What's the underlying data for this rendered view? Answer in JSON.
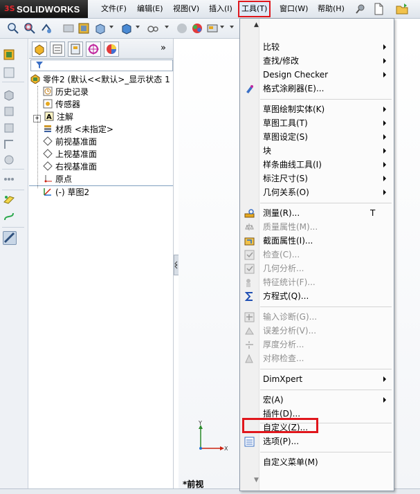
{
  "app": {
    "logo_mark": "3S",
    "logo_text": "SOLIDWORKS"
  },
  "menubar": [
    "文件(F)",
    "编辑(E)",
    "视图(V)",
    "插入(I)",
    "工具(T)",
    "窗口(W)",
    "帮助(H)"
  ],
  "feature_tree": {
    "items": [
      "零件2 (默认<<默认>_显示状态 1",
      "历史记录",
      "传感器",
      "注解",
      "材质 <未指定>",
      "前视基准面",
      "上视基准面",
      "右视基准面",
      "原点",
      "(-) 草图2"
    ],
    "expand_glyph": "+",
    "tab_more": "»"
  },
  "view": {
    "label": "*前视",
    "axis_x": "X",
    "axis_y": "Y"
  },
  "tools_menu": {
    "scroll_up": "▲",
    "scroll_down": "▼",
    "items": [
      "比较",
      "查找/修改",
      "Design Checker",
      "格式涂刷器(E)...",
      "草图绘制实体(K)",
      "草图工具(T)",
      "草图设定(S)",
      "块",
      "样条曲线工具(I)",
      "标注尺寸(S)",
      "几何关系(O)",
      "测量(R)...",
      "质量属性(M)...",
      "截面属性(I)...",
      "检查(C)...",
      "几何分析...",
      "特征统计(F)...",
      "方程式(Q)...",
      "输入诊断(G)...",
      "误差分析(V)...",
      "厚度分析...",
      "对称检查...",
      "DimXpert",
      "宏(A)",
      "插件(D)...",
      "自定义(Z)...",
      "选项(P)...",
      "自定义菜单(M)"
    ],
    "shortcut_measure": "T"
  },
  "colors": {
    "highlight": "#e0161c"
  }
}
